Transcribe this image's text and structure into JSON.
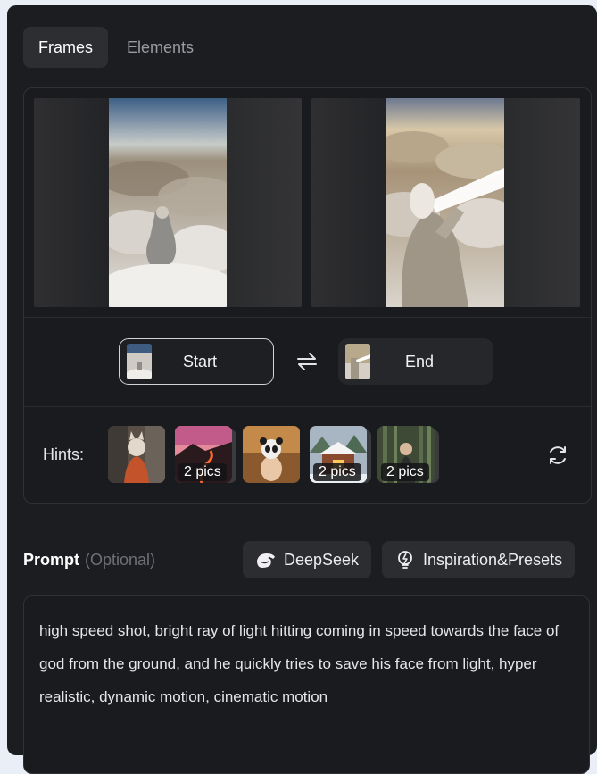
{
  "tabs": [
    {
      "label": "Frames",
      "active": true
    },
    {
      "label": "Elements",
      "active": false
    }
  ],
  "frames": {
    "start_label": "Start",
    "end_label": "End"
  },
  "hints": {
    "label": "Hints:",
    "items": [
      {
        "name": "cat-soldier",
        "badge": ""
      },
      {
        "name": "lava-landscape",
        "badge": "2 pics"
      },
      {
        "name": "panda",
        "badge": ""
      },
      {
        "name": "snowy-village",
        "badge": "2 pics"
      },
      {
        "name": "bamboo-forest",
        "badge": "2 pics"
      }
    ]
  },
  "prompt": {
    "title": "Prompt",
    "optional": "(Optional)",
    "deepseek_label": "DeepSeek",
    "inspiration_label": "Inspiration&Presets",
    "text": "high speed shot, bright ray of light hitting coming in speed towards the face of god from the ground, and he quickly tries to save his face from light, hyper realistic, dynamic motion, cinematic motion"
  },
  "colors": {
    "panel": "#1c1d20",
    "page": "#e9eef7",
    "pill": "#2c2d31"
  }
}
